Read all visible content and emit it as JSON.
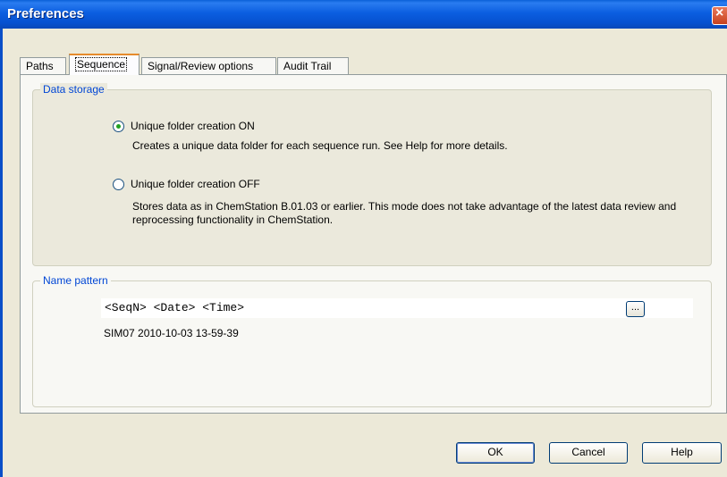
{
  "window": {
    "title": "Preferences",
    "close_label": "×"
  },
  "tabs": [
    {
      "label": "Paths",
      "active": false
    },
    {
      "label": "Sequence",
      "active": true
    },
    {
      "label": "Signal/Review options",
      "active": false
    },
    {
      "label": "Audit Trail",
      "active": false
    }
  ],
  "data_storage": {
    "legend": "Data storage",
    "options": [
      {
        "label": "Unique folder creation ON",
        "selected": true,
        "description": "Creates a unique data folder for each sequence run. See Help for more details."
      },
      {
        "label": "Unique folder creation OFF",
        "selected": false,
        "description": "Stores data as in ChemStation B.01.03 or earlier. This mode does not take advantage of the latest data review and reprocessing functionality in ChemStation."
      }
    ]
  },
  "name_pattern": {
    "legend": "Name pattern",
    "value": "<SeqN> <Date> <Time>",
    "browse_label": "...",
    "preview": "SIM07 2010-10-03 13-59-39"
  },
  "buttons": {
    "ok": "OK",
    "cancel": "Cancel",
    "help": "Help"
  },
  "colors": {
    "title_bar": "#0a5fd8",
    "group_legend": "#0046d5",
    "active_tab_highlight": "#e68b2c",
    "radio_dot": "#21a121"
  }
}
